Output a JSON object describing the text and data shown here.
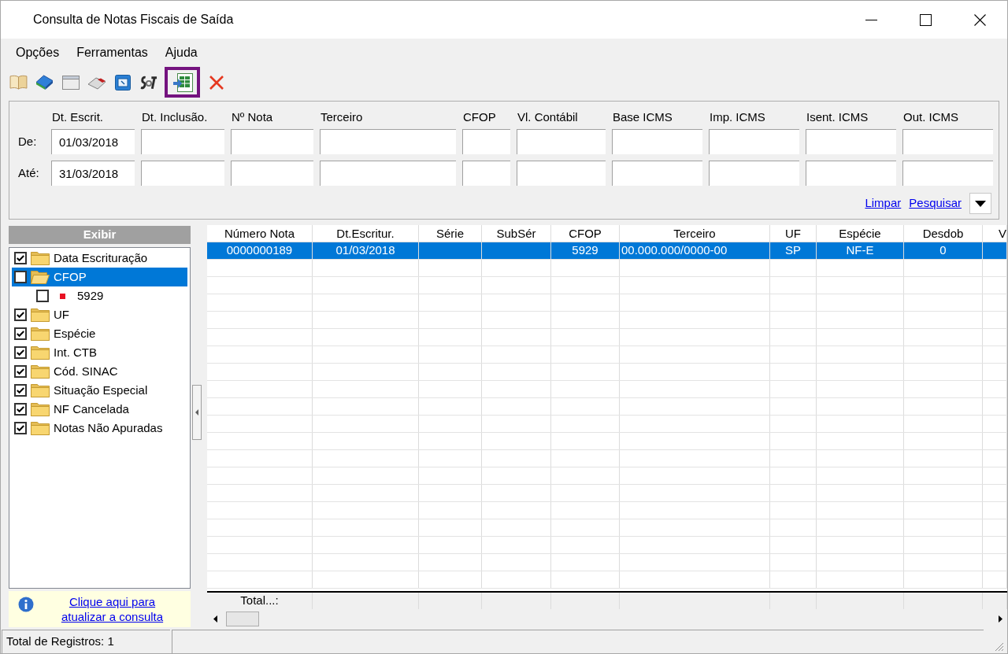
{
  "window": {
    "title": "Consulta de Notas Fiscais de Saída"
  },
  "menu": [
    "Opções",
    "Ferramentas",
    "Ajuda"
  ],
  "toolbar": [
    {
      "kind": "book",
      "selected": false
    },
    {
      "kind": "closed_book",
      "selected": false
    },
    {
      "kind": "window",
      "selected": false
    },
    {
      "kind": "eraser",
      "selected": false
    },
    {
      "kind": "form",
      "selected": false
    },
    {
      "kind": "logo",
      "selected": false
    },
    {
      "kind": "spreadsheet",
      "selected": true
    },
    {
      "kind": "cross",
      "selected": false
    }
  ],
  "filters": {
    "row_labels": [
      "De:",
      "Até:"
    ],
    "fields": [
      {
        "label": "Dt. Escrit.",
        "from": "01/03/2018",
        "to": "31/03/2018"
      },
      {
        "label": "Dt. Inclusão."
      },
      {
        "label": "Nº Nota"
      },
      {
        "label": "Terceiro"
      },
      {
        "label": "CFOP"
      },
      {
        "label": "Vl. Contábil"
      },
      {
        "label": "Base ICMS"
      },
      {
        "label": "Imp. ICMS"
      },
      {
        "label": "Isent. ICMS"
      },
      {
        "label": "Out. ICMS"
      }
    ],
    "links": [
      "Limpar",
      "Pesquisar"
    ]
  },
  "display_panel": {
    "title": "Exibir",
    "items": [
      {
        "label": "Data Escrituração",
        "checked": true,
        "expanded": false,
        "selected": false
      },
      {
        "label": "CFOP",
        "checked": false,
        "expanded": true,
        "selected": true,
        "children": [
          {
            "label": "5929",
            "checked": false,
            "selected": false,
            "color": "#e81123"
          }
        ]
      },
      {
        "label": "UF",
        "checked": true,
        "expanded": false,
        "selected": false
      },
      {
        "label": "Espécie",
        "checked": true,
        "expanded": false,
        "selected": false
      },
      {
        "label": "Int. CTB",
        "checked": true,
        "expanded": false,
        "selected": false
      },
      {
        "label": "Cód. SINAC",
        "checked": true,
        "expanded": false,
        "selected": false
      },
      {
        "label": "Situação Especial",
        "checked": true,
        "expanded": false,
        "selected": false
      },
      {
        "label": "NF Cancelada",
        "checked": true,
        "expanded": false,
        "selected": false
      },
      {
        "label": "Notas Não Apuradas",
        "checked": true,
        "expanded": false,
        "selected": false
      }
    ],
    "refresh_link": "Clique aqui para atualizar a consulta"
  },
  "grid": {
    "columns": [
      "Número Nota",
      "Dt.Escritur.",
      "Série",
      "SubSér",
      "CFOP",
      "Terceiro",
      "UF",
      "Espécie",
      "Desdob",
      "V"
    ],
    "rows": [
      {
        "selected": true,
        "numero_nota": "0000000189",
        "dt_escritur": "01/03/2018",
        "cfop": "5929",
        "terceiro": "00.000.000/0000-00",
        "uf": "SP",
        "especie": "NF-E",
        "desdob": "0"
      }
    ],
    "total_label": "Total...:"
  },
  "status_bar": {
    "records": "Total de Registros: 1"
  }
}
